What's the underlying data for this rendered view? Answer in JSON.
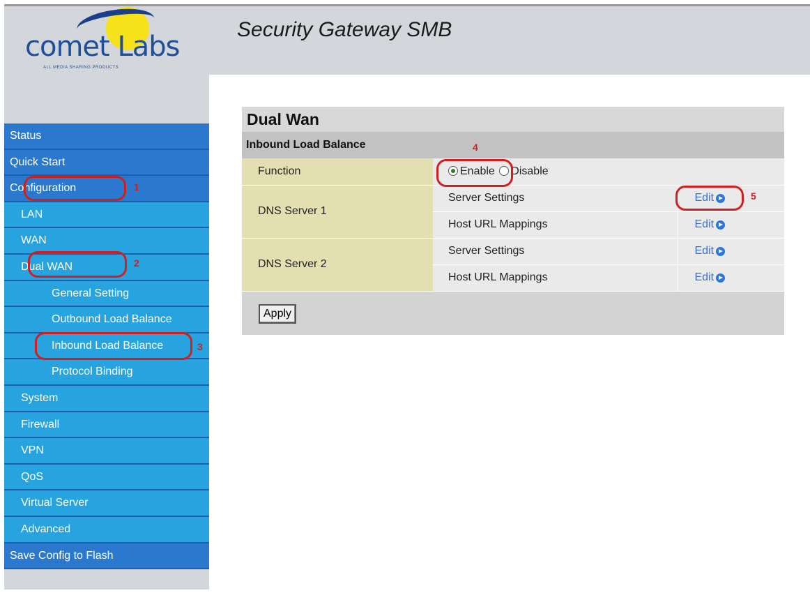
{
  "brand": {
    "name": "comet Labs",
    "tagline": "ALL MEDIA SHARING PRODUCTS"
  },
  "header": {
    "title": "Security Gateway SMB"
  },
  "nav": {
    "items": [
      {
        "label": "Status",
        "level": 0
      },
      {
        "label": "Quick Start",
        "level": 0
      },
      {
        "label": "Configuration",
        "level": 0
      },
      {
        "label": "LAN",
        "level": 1
      },
      {
        "label": "WAN",
        "level": 1
      },
      {
        "label": "Dual WAN",
        "level": 1
      },
      {
        "label": "General Setting",
        "level": 2
      },
      {
        "label": "Outbound Load Balance",
        "level": 2
      },
      {
        "label": "Inbound Load Balance",
        "level": 2
      },
      {
        "label": "Protocol Binding",
        "level": 2
      },
      {
        "label": "System",
        "level": 1
      },
      {
        "label": "Firewall",
        "level": 1
      },
      {
        "label": "VPN",
        "level": 1
      },
      {
        "label": "QoS",
        "level": 1
      },
      {
        "label": "Virtual Server",
        "level": 1
      },
      {
        "label": "Advanced",
        "level": 1
      },
      {
        "label": "Save Config to Flash",
        "level": 0
      }
    ]
  },
  "panel": {
    "title": "Dual Wan",
    "section": "Inbound Load Balance",
    "function_label": "Function",
    "enable_label": "Enable",
    "disable_label": "Disable",
    "selected": "Enable",
    "dns1": {
      "label": "DNS Server 1",
      "row1": "Server Settings",
      "row2": "Host URL Mappings"
    },
    "dns2": {
      "label": "DNS Server 2",
      "row1": "Server Settings",
      "row2": "Host URL Mappings"
    },
    "edit_label": "Edit",
    "apply_label": "Apply"
  },
  "annotations": [
    "1",
    "2",
    "3",
    "4",
    "5"
  ],
  "colors": {
    "annotation": "#d11f1f",
    "nav_top": "#2a79cf",
    "nav_sub": "#27a3e0",
    "label_cell": "#e3dfb1",
    "link": "#3a6fcf"
  }
}
